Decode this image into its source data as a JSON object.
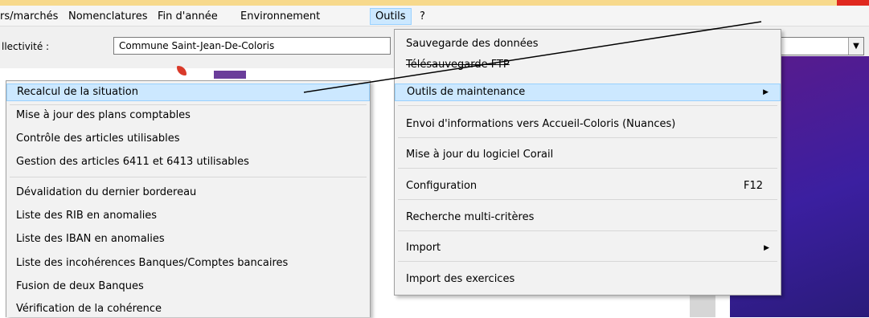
{
  "menubar": {
    "items": [
      "rs/marchés",
      "Nomenclatures",
      "Fin d'année",
      "Environnement",
      "Outils",
      "?"
    ]
  },
  "toolbar": {
    "collectivite_label": "llectivité :",
    "collectivite_value": "Commune Saint-Jean-De-Coloris"
  },
  "left_menu": {
    "items": [
      "Recalcul de la situation",
      "Mise à jour des plans comptables",
      "Contrôle des articles utilisables",
      "Gestion des articles 6411 et 6413 utilisables",
      "Dévalidation du dernier bordereau",
      "Liste des RIB en anomalies",
      "Liste des IBAN en anomalies",
      "Liste des incohérences Banques/Comptes bancaires",
      "Fusion de deux Banques",
      "Vérification de la cohérence"
    ]
  },
  "outils_menu": {
    "items": [
      "Sauvegarde des données",
      "Télésauvegarde FTP",
      "Outils de maintenance",
      "Envoi d'informations vers Accueil-Coloris (Nuances)",
      "Mise à jour du logiciel Corail",
      "Configuration",
      "Recherche multi-critères",
      "Import",
      "Import des exercices"
    ],
    "configuration_shortcut": "F12"
  },
  "colors": {
    "highlight": "#cce8ff",
    "highlight_border": "#99d1ff",
    "menu_bg": "#f2f2f2",
    "purple_panel": "#4a1f9a"
  },
  "icons": [
    "submenu-arrow-icon",
    "dropdown-arrow-icon"
  ]
}
